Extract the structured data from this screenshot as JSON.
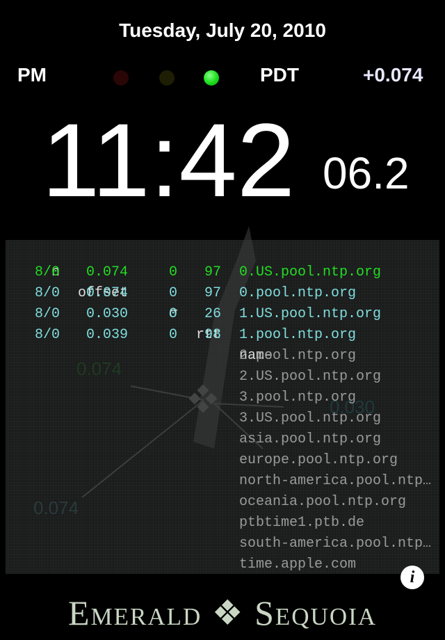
{
  "date": "Tuesday, July 20, 2010",
  "ampm": "PM",
  "timezone": "PDT",
  "offset": "+0.074",
  "status_lights": {
    "red": false,
    "yellow": false,
    "green": true,
    "colors": {
      "red": "#2a0606",
      "yellow": "#1e1e04",
      "green": "#22e022"
    }
  },
  "time": "11:42",
  "seconds": "06.2",
  "table": {
    "headers": {
      "n": "n",
      "offset": "offset",
      "sigma": "σ",
      "rtt": "rtt",
      "name": "name"
    },
    "rows": [
      {
        "n": "8/0",
        "offset": "0.074",
        "sigma": "0",
        "rtt": "97",
        "name": "0.US.pool.ntp.org",
        "color": "#22dd22"
      },
      {
        "n": "8/0",
        "offset": "0.074",
        "sigma": "0",
        "rtt": "97",
        "name": "0.pool.ntp.org",
        "color": "#7fdedc"
      },
      {
        "n": "8/0",
        "offset": "0.030",
        "sigma": "0",
        "rtt": "26",
        "name": "1.US.pool.ntp.org",
        "color": "#7fdedc"
      },
      {
        "n": "8/0",
        "offset": "0.039",
        "sigma": "0",
        "rtt": "98",
        "name": "1.pool.ntp.org",
        "color": "#7fdedc"
      }
    ],
    "inactive": [
      "2.pool.ntp.org",
      "2.US.pool.ntp.org",
      "3.pool.ntp.org",
      "3.US.pool.ntp.org",
      "asia.pool.ntp.org",
      "europe.pool.ntp.org",
      "north-america.pool.ntp.org",
      "oceania.pool.ntp.org",
      "ptbtime1.ptb.de",
      "south-america.pool.ntp.org",
      "time.apple.com"
    ]
  },
  "ghost_labels": [
    "0.074",
    "0.030",
    "0.074"
  ],
  "brand": "Emerald ❖ Sequoia",
  "info_label": "i"
}
